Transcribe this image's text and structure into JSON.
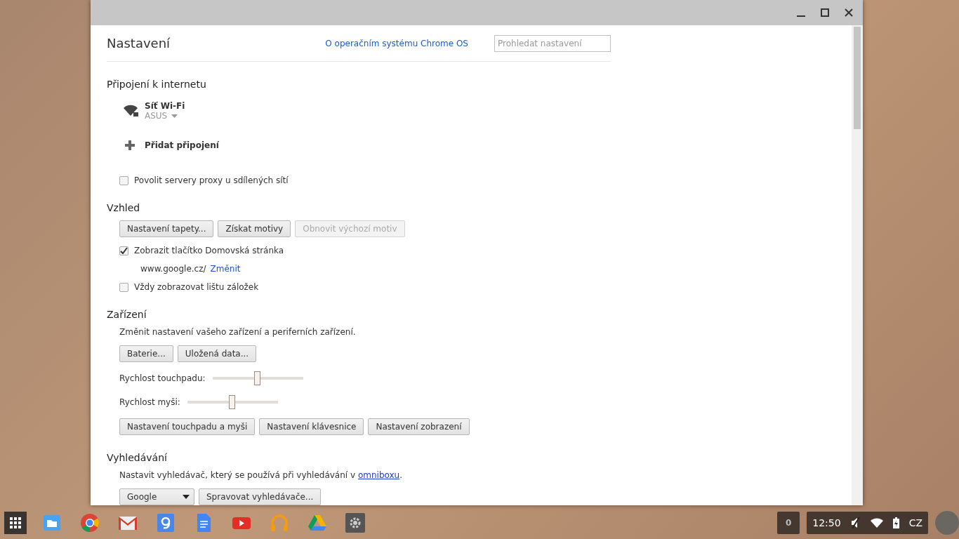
{
  "settings": {
    "title": "Nastavení",
    "about_link": "O operačním systému Chrome OS",
    "search": {
      "placeholder": "Prohledat nastavení"
    }
  },
  "sections": [
    {
      "title": "Připojení k internetu",
      "items": [
        {
          "kind": "network",
          "name": "Síť Wi-Fi",
          "ssid": "ASUS"
        },
        {
          "kind": "add",
          "label": "Přidat připojení"
        },
        {
          "kind": "checkbox",
          "label": "Povolit servery proxy u sdílených sítí",
          "checked": false
        }
      ]
    },
    {
      "title": "Vzhled",
      "items": [
        {
          "kind": "buttons",
          "buttons": [
            {
              "label": "Nastavení tapety...",
              "disabled": false
            },
            {
              "label": "Získat motivy",
              "disabled": false
            },
            {
              "label": "Obnovit výchozí motiv",
              "disabled": true
            }
          ]
        },
        {
          "kind": "checkbox",
          "label": "Zobrazit tlačítko Domovská stránka",
          "checked": true
        },
        {
          "kind": "homepage",
          "url": "www.google.cz/",
          "link": "Změnit"
        },
        {
          "kind": "checkbox",
          "label": "Vždy zobrazovat lištu záložek",
          "checked": false
        }
      ]
    },
    {
      "title": "Zařízení",
      "items": [
        {
          "kind": "text",
          "text": "Změnit nastavení vašeho zařízení a periferních zařízení."
        },
        {
          "kind": "buttons",
          "buttons": [
            {
              "label": "Baterie...",
              "disabled": false
            },
            {
              "label": "Uložená data...",
              "disabled": false
            }
          ]
        },
        {
          "kind": "slider",
          "label": "Rychlost touchpadu:",
          "level": 0.5
        },
        {
          "kind": "slider",
          "label": "Rychlost myši:",
          "level": 0.5
        },
        {
          "kind": "buttons",
          "buttons": [
            {
              "label": "Nastavení touchpadu a myši",
              "disabled": false
            },
            {
              "label": "Nastavení klávesnice",
              "disabled": false
            },
            {
              "label": "Nastavení zobrazení",
              "disabled": false
            }
          ]
        }
      ]
    },
    {
      "title": "Vyhledávání",
      "items": [
        {
          "kind": "text",
          "text": "Nastavit vyhledávač, který se používá při vyhledávání v ",
          "link": "omniboxu",
          "after": "."
        },
        {
          "kind": "engine",
          "select": "Google",
          "button": "Spravovat vyhledávače..."
        }
      ]
    }
  ],
  "shelf": {
    "notifications": "0",
    "time": "12:50",
    "input_method": "CZ"
  }
}
